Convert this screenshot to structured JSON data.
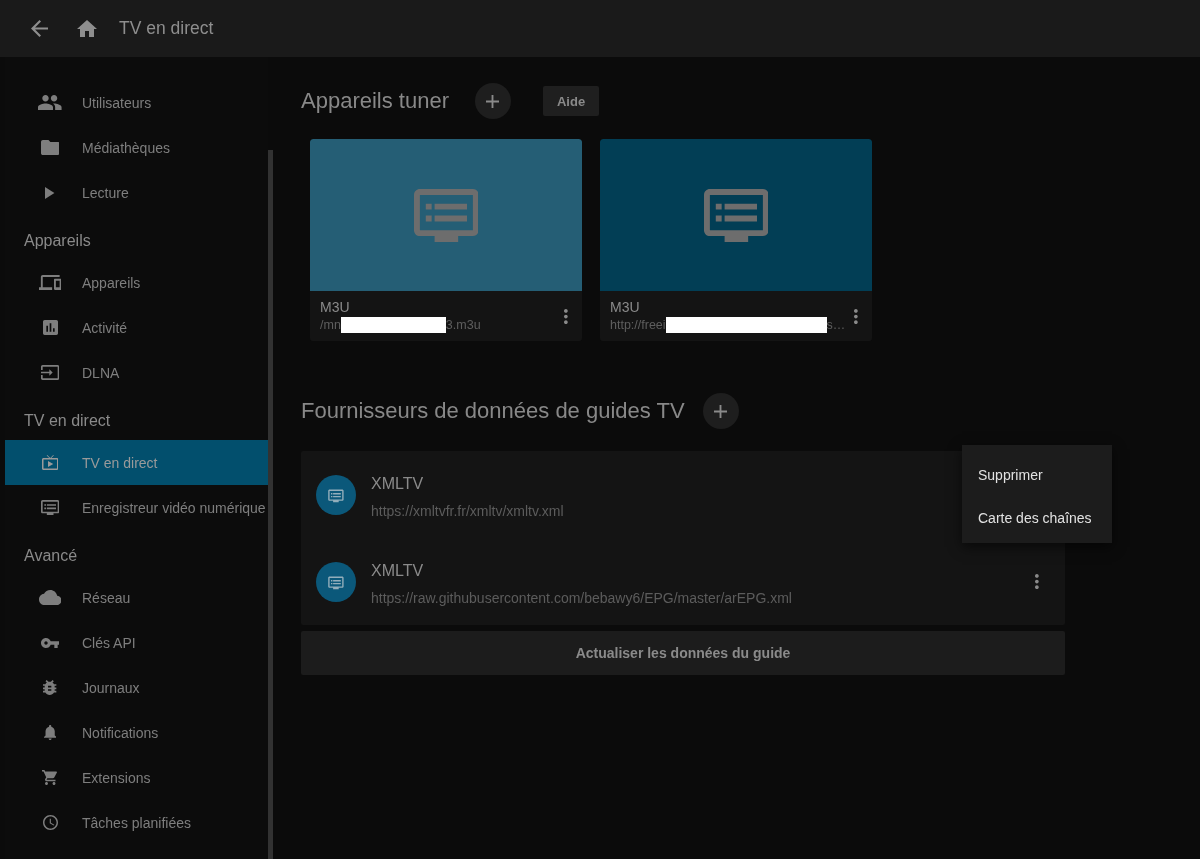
{
  "header": {
    "title": "TV en direct"
  },
  "sidebar": {
    "sections": [
      {
        "items": [
          {
            "label": "Utilisateurs",
            "selected": false
          },
          {
            "label": "Médiathèques",
            "selected": false
          },
          {
            "label": "Lecture",
            "selected": false
          }
        ]
      },
      {
        "heading": "Appareils",
        "items": [
          {
            "label": "Appareils",
            "selected": false
          },
          {
            "label": "Activité",
            "selected": false
          },
          {
            "label": "DLNA",
            "selected": false
          }
        ]
      },
      {
        "heading": "TV en direct",
        "items": [
          {
            "label": "TV en direct",
            "selected": true
          },
          {
            "label": "Enregistreur vidéo numérique",
            "selected": false
          }
        ]
      },
      {
        "heading": "Avancé",
        "items": [
          {
            "label": "Réseau",
            "selected": false
          },
          {
            "label": "Clés API",
            "selected": false
          },
          {
            "label": "Journaux",
            "selected": false
          },
          {
            "label": "Notifications",
            "selected": false
          },
          {
            "label": "Extensions",
            "selected": false
          },
          {
            "label": "Tâches planifiées",
            "selected": false
          }
        ]
      }
    ]
  },
  "tuners": {
    "heading": "Appareils tuner",
    "help_button": "Aide",
    "cards": [
      {
        "color": "#255e75",
        "title": "M3U",
        "path_start": "/mn",
        "path_end": "3.m3u"
      },
      {
        "color": "#023e55",
        "title": "M3U",
        "path_start": "http://freei",
        "path_end": "s…"
      }
    ]
  },
  "guide_providers": {
    "heading": "Fournisseurs de données de guides TV",
    "rows": [
      {
        "title": "XMLTV",
        "url": "https://xmltvfr.fr/xmltv/xmltv.xml",
        "menu_open": true
      },
      {
        "title": "XMLTV",
        "url": "https://raw.githubusercontent.com/bebawy6/EPG/master/arEPG.xml",
        "menu_open": false
      }
    ],
    "refresh_button": "Actualiser les données du guide"
  },
  "context_menu": {
    "items": [
      "Supprimer",
      "Carte des chaînes"
    ]
  }
}
